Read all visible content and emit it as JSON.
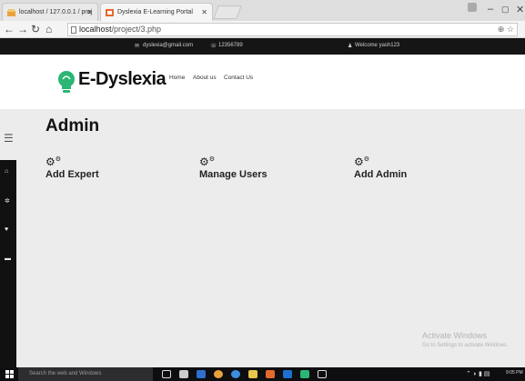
{
  "browser": {
    "tabs": [
      {
        "label": "localhost / 127.0.0.1 / proj"
      },
      {
        "label": "Dyslexia E-Learning Portal"
      }
    ],
    "url_host": "localhost",
    "url_path": "/project/3.php"
  },
  "topbar": {
    "email": "dyslexia@gmail.com",
    "phone": "12356789",
    "welcome": "Welcome yash123"
  },
  "header": {
    "logo_text": "E-Dyslexia",
    "menu": [
      "Home",
      "About us",
      "Contact Us"
    ]
  },
  "main": {
    "title": "Admin",
    "actions": [
      {
        "label": "Add Expert",
        "icon": "cogs-icon"
      },
      {
        "label": "Manage Users",
        "icon": "cogs-icon"
      },
      {
        "label": "Add Admin",
        "icon": "cogs-icon"
      }
    ]
  },
  "watermark": {
    "line1": "Activate Windows",
    "line2": "Go to Settings to activate Windows."
  },
  "taskbar": {
    "search_placeholder": "Search the web and Windows",
    "time": "9:05 PM"
  },
  "colors": {
    "logo_green": "#2bb673",
    "topbar_bg": "#151515",
    "sidebar_bg": "#111111",
    "content_bg": "#ececec"
  }
}
